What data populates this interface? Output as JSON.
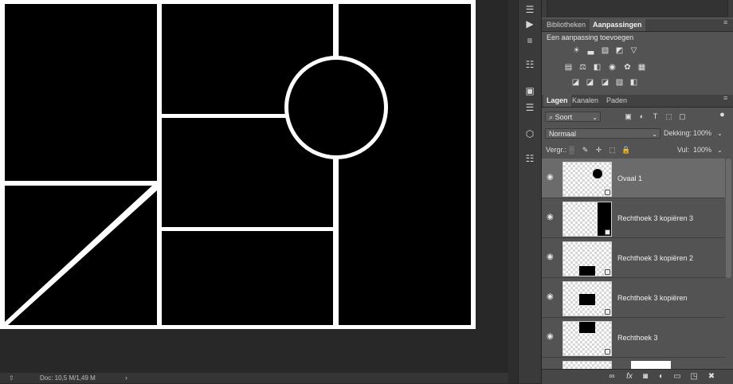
{
  "status": {
    "doc_info": "Doc: 10,5 M/1,49 M",
    "arrow": "›",
    "share_icon": "share-icon"
  },
  "panels": {
    "top_tabs": [
      "Bibliotheken",
      "Aanpassingen"
    ],
    "adjustments_title": "Een aanpassing toevoegen",
    "layer_tabs": [
      "Lagen",
      "Kanalen",
      "Paden"
    ]
  },
  "layers_controls": {
    "filter_label": "Soort",
    "blend_mode": "Normaal",
    "opacity_label": "Dekking:",
    "opacity_value": "100%",
    "lock_label": "Vergr.:",
    "fill_label": "Vul:",
    "fill_value": "100%"
  },
  "layers": [
    {
      "name": "Ovaal 1",
      "selected": true,
      "visible": true
    },
    {
      "name": "Rechthoek 3 kopiëren 3",
      "selected": false,
      "visible": true
    },
    {
      "name": "Rechthoek 3 kopiëren 2",
      "selected": false,
      "visible": true
    },
    {
      "name": "Rechthoek 3 kopiëren",
      "selected": false,
      "visible": true
    },
    {
      "name": "Rechthoek 3",
      "selected": false,
      "visible": true
    }
  ],
  "colors": {
    "canvas_background": "#282828",
    "panel_background": "#535353",
    "selected_layer": "#6b6b6b",
    "artboard_lines": "#ffffff",
    "artboard_fill": "#000000"
  }
}
